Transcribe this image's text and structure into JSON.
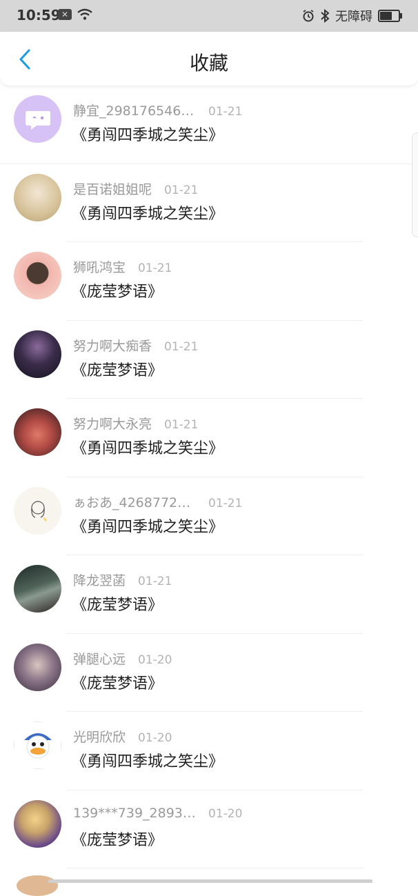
{
  "status_bar": {
    "time": "10:59",
    "accessibility_label": "无障碍",
    "battery_level": 0.6
  },
  "header": {
    "title": "收藏",
    "accent_color": "#1a9be6"
  },
  "favorites": [
    {
      "user": "静宜_2981765468...",
      "date": "01-21",
      "title": "《勇闯四季城之笑尘》",
      "avatar_color": "#d7c2f5"
    },
    {
      "user": "是百诺姐姐呢",
      "date": "01-21",
      "title": "《勇闯四季城之笑尘》",
      "avatar_color": "#cdbf9a"
    },
    {
      "user": "狮吼鸿宝",
      "date": "01-21",
      "title": "《庞莹梦语》",
      "avatar_color": "#f1b6ad"
    },
    {
      "user": "努力啊大痴香",
      "date": "01-21",
      "title": "《庞莹梦语》",
      "avatar_color": "#2e2a45"
    },
    {
      "user": "努力啊大永亮",
      "date": "01-21",
      "title": "《勇闯四季城之笑尘》",
      "avatar_color": "#8a3a3a"
    },
    {
      "user": "ぁおあ_42687728...",
      "date": "01-21",
      "title": "《勇闯四季城之笑尘》",
      "avatar_color": "#f3f0e6"
    },
    {
      "user": "降龙翌菡",
      "date": "01-21",
      "title": "《庞莹梦语》",
      "avatar_color": "#3c4a44"
    },
    {
      "user": "弹腿心远",
      "date": "01-20",
      "title": "《庞莹梦语》",
      "avatar_color": "#6a5a74"
    },
    {
      "user": "光明欣欣",
      "date": "01-20",
      "title": "《勇闯四季城之笑尘》",
      "avatar_color": "#ffffff"
    },
    {
      "user": "139***739_28933...",
      "date": "01-20",
      "title": "《庞莹梦语》",
      "avatar_color": "#c9a46a"
    }
  ]
}
